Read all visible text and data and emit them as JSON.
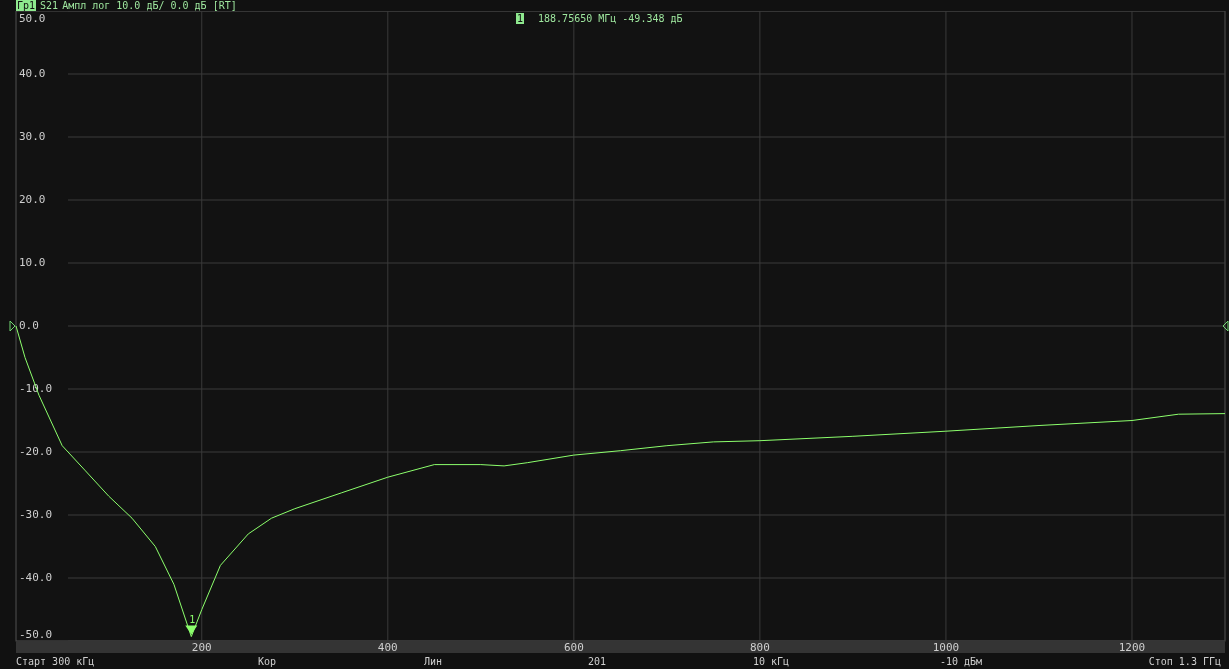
{
  "header": {
    "trace_badge": "Гр1",
    "trace_info": "Ампл лог 10.0 дБ/ 0.0 дБ [RT]"
  },
  "marker_readout": {
    "badge": "1",
    "value": "188.75650 МГц -49.348 дБ"
  },
  "chart_data": {
    "type": "line",
    "grid": true,
    "xlim": [
      0.3,
      1300
    ],
    "ylim": [
      -50,
      50
    ],
    "xticks": [
      200,
      400,
      600,
      800,
      1000,
      1200
    ],
    "yticks": [
      {
        "value": 50,
        "label": "50.0"
      },
      {
        "value": 40,
        "label": "40.0"
      },
      {
        "value": 30,
        "label": "30.0"
      },
      {
        "value": 20,
        "label": "20.0"
      },
      {
        "value": 10,
        "label": "10.0"
      },
      {
        "value": 0,
        "label": "0.0"
      },
      {
        "value": -10,
        "label": "-10.0"
      },
      {
        "value": -20,
        "label": "-20.0"
      },
      {
        "value": -30,
        "label": "-30.0"
      },
      {
        "value": -40,
        "label": "-40.0"
      },
      {
        "value": -50,
        "label": "-50.0"
      }
    ],
    "x": [
      0.3,
      10,
      25,
      50,
      75,
      100,
      125,
      150,
      170,
      188.76,
      200,
      220,
      250,
      275,
      300,
      350,
      400,
      450,
      500,
      525,
      550,
      600,
      650,
      700,
      750,
      800,
      900,
      1000,
      1100,
      1200,
      1250,
      1300
    ],
    "series": [
      {
        "name": "S21",
        "color": "#8cff6c",
        "values": [
          0,
          -5,
          -11,
          -19,
          -23,
          -27,
          -30.5,
          -35,
          -41,
          -49.3,
          -45,
          -38,
          -33,
          -30.5,
          -29,
          -26.5,
          -24,
          -22,
          -22,
          -22.2,
          -21.7,
          -20.5,
          -19.8,
          -19,
          -18.4,
          -18.2,
          -17.5,
          -16.7,
          -15.8,
          -15,
          -14,
          -13.9
        ]
      }
    ],
    "annotations": [
      {
        "text": "1"
      }
    ]
  },
  "status_bar": [
    "Старт 300 кГц",
    "Кор",
    "Лин",
    "201",
    "10 кГц",
    "-10 дБм",
    "Стоп 1.3 ГГц"
  ]
}
